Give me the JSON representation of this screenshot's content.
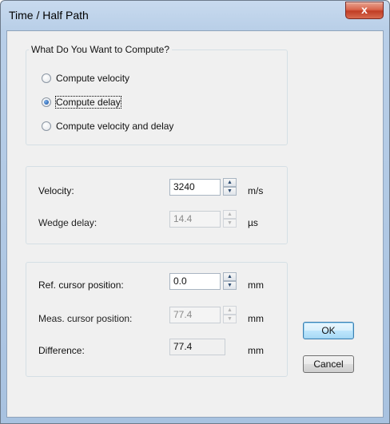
{
  "window": {
    "title": "Time / Half Path",
    "close_glyph": "x"
  },
  "compute_group": {
    "legend": "What Do You Want to Compute?",
    "options": [
      {
        "label": "Compute velocity",
        "checked": false
      },
      {
        "label": "Compute delay",
        "checked": true
      },
      {
        "label": "Compute velocity and delay",
        "checked": false
      }
    ]
  },
  "velocity_group": {
    "velocity_label": "Velocity:",
    "velocity_value": "3240",
    "velocity_unit": "m/s",
    "wedge_label": "Wedge delay:",
    "wedge_value": "14.4",
    "wedge_unit": "µs"
  },
  "cursor_group": {
    "ref_label": "Ref. cursor position:",
    "ref_value": "0.0",
    "ref_unit": "mm",
    "meas_label": "Meas. cursor position:",
    "meas_value": "77.4",
    "meas_unit": "mm",
    "diff_label": "Difference:",
    "diff_value": "77.4",
    "diff_unit": "mm"
  },
  "buttons": {
    "ok": "OK",
    "cancel": "Cancel"
  },
  "spin_glyphs": {
    "up": "▲",
    "down": "▼"
  }
}
